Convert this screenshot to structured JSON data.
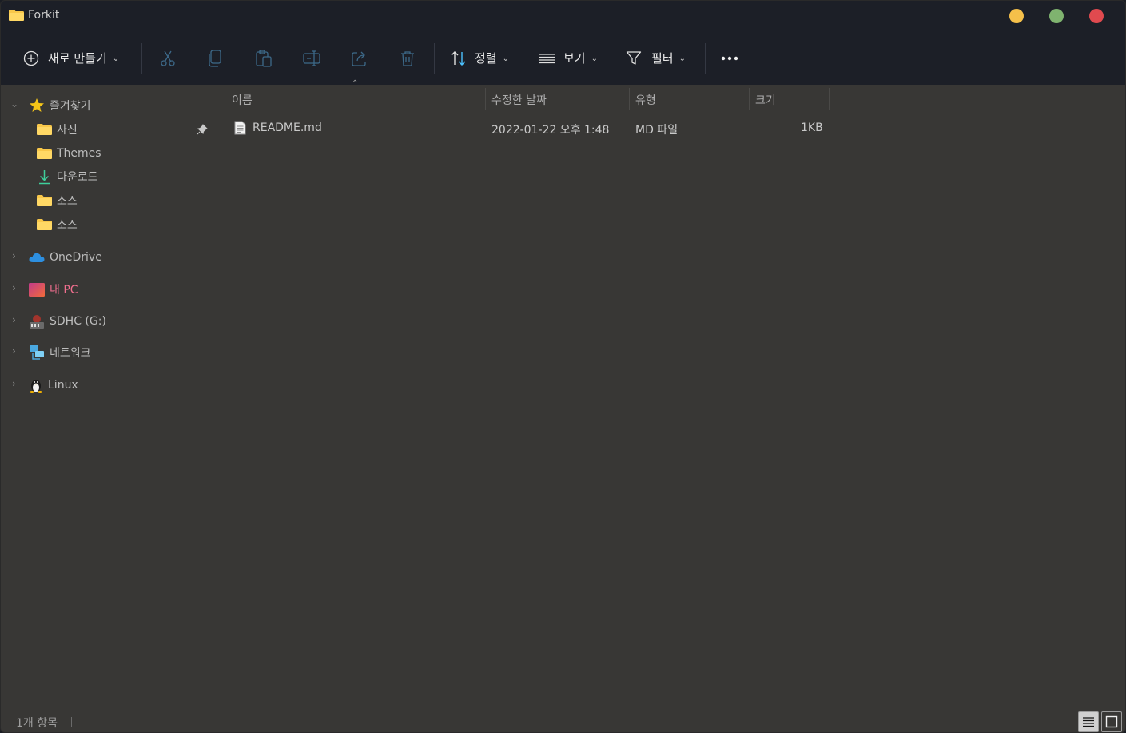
{
  "window": {
    "title": "Forkit"
  },
  "toolbar": {
    "new_label": "새로 만들기",
    "sort_label": "정렬",
    "view_label": "보기",
    "filter_label": "필터"
  },
  "sidebar": {
    "favorites": {
      "label": "즐겨찾기",
      "items": [
        {
          "label": "사진",
          "icon": "folder-icon",
          "pinned": true
        },
        {
          "label": "Themes",
          "icon": "folder-icon"
        },
        {
          "label": "다운로드",
          "icon": "download-icon"
        },
        {
          "label": "소스",
          "icon": "folder-icon"
        },
        {
          "label": "소스",
          "icon": "folder-icon"
        }
      ]
    },
    "locations": [
      {
        "label": "OneDrive",
        "icon": "onedrive-icon"
      },
      {
        "label": "내 PC",
        "icon": "pc-icon"
      },
      {
        "label": "SDHC (G:)",
        "icon": "drive-icon"
      },
      {
        "label": "네트워크",
        "icon": "network-icon"
      },
      {
        "label": "Linux",
        "icon": "linux-icon"
      }
    ]
  },
  "columns": {
    "name": "이름",
    "modified": "수정한 날짜",
    "type": "유형",
    "size": "크기"
  },
  "files": [
    {
      "name": "README.md",
      "modified": "2022-01-22 오후 1:48",
      "type": "MD 파일",
      "size": "1KB"
    }
  ],
  "status": {
    "item_count": "1개 항목"
  },
  "colors": {
    "accent": "#4cc2ff",
    "folder": "#f8c74a",
    "titlebar": "#1c1f27",
    "content": "#383735"
  }
}
